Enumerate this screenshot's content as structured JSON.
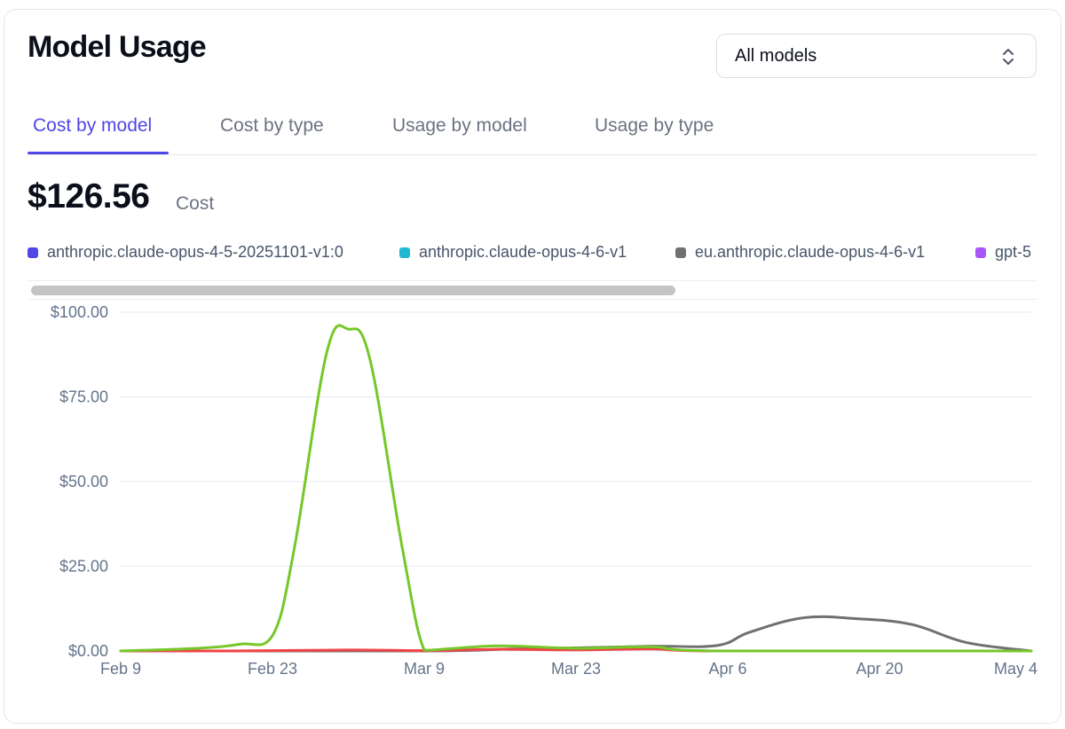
{
  "header": {
    "title": "Model Usage",
    "model_select": {
      "value": "All models",
      "icon": "chevron-up-down-icon"
    }
  },
  "tabs": [
    {
      "label": "Cost by model",
      "active": true
    },
    {
      "label": "Cost by type",
      "active": false
    },
    {
      "label": "Usage by model",
      "active": false
    },
    {
      "label": "Usage by type",
      "active": false
    }
  ],
  "summary": {
    "total": "$126.56",
    "label": "Cost"
  },
  "legend": [
    {
      "label": "anthropic.claude-opus-4-5-20251101-v1:0",
      "color": "#4f46e5"
    },
    {
      "label": "anthropic.claude-opus-4-6-v1",
      "color": "#22b8d4"
    },
    {
      "label": "eu.anthropic.claude-opus-4-6-v1",
      "color": "#707070"
    },
    {
      "label": "gpt-5",
      "color": "#a855f7"
    }
  ],
  "chart_data": {
    "type": "line",
    "ylim": [
      0,
      100
    ],
    "yticks": [
      "$0.00",
      "$25.00",
      "$50.00",
      "$75.00",
      "$100.00"
    ],
    "ytick_values": [
      0,
      25,
      50,
      75,
      100
    ],
    "xlim": [
      0,
      84
    ],
    "xticks": [
      "Feb 9",
      "Feb 23",
      "Mar 9",
      "Mar 23",
      "Apr 6",
      "Apr 20",
      "May 4"
    ],
    "xtick_values": [
      0,
      14,
      28,
      42,
      56,
      70,
      84
    ],
    "grid": true,
    "series": [
      {
        "name": "eu.anthropic.claude-opus-4-6-v1",
        "color": "#707070",
        "x": [
          0,
          28,
          36,
          42,
          49,
          55,
          58,
          63,
          68,
          73,
          78,
          84
        ],
        "y": [
          0,
          0,
          0.6,
          0.9,
          1.4,
          1.6,
          5.5,
          9.8,
          9.5,
          7.8,
          2.5,
          0
        ]
      },
      {
        "name": "",
        "color": "#ef4444",
        "x": [
          0,
          10,
          21,
          28,
          35,
          42,
          49,
          55,
          84
        ],
        "y": [
          0,
          0,
          0.3,
          0.1,
          0.5,
          0.3,
          0.6,
          0,
          0
        ]
      },
      {
        "name": "",
        "color": "#76c729",
        "x": [
          0,
          7,
          11,
          14,
          16,
          19,
          21,
          23,
          26,
          28,
          30,
          35,
          42,
          49,
          55,
          84
        ],
        "y": [
          0,
          0.8,
          2,
          4.5,
          30,
          88,
          95,
          86,
          30,
          0.3,
          0.6,
          1.5,
          0.8,
          1.2,
          0,
          0
        ]
      }
    ]
  }
}
